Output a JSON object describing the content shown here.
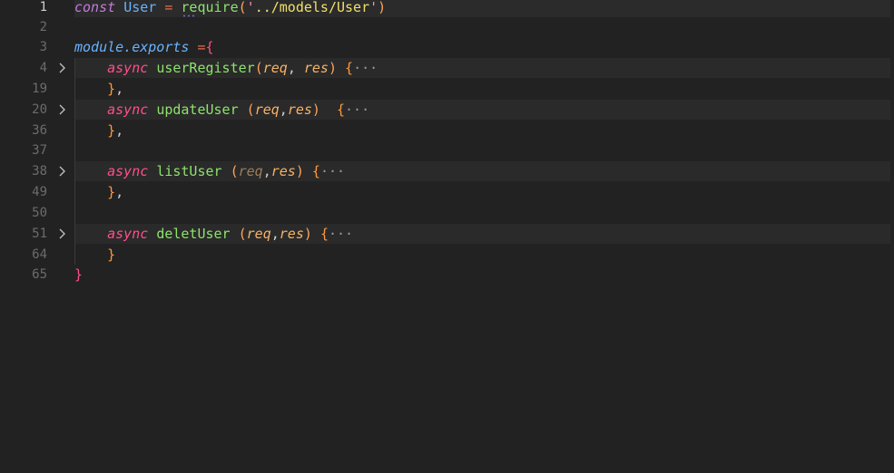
{
  "editor": {
    "lines": [
      {
        "num": "1",
        "kw": "const",
        "name": "User",
        "op": "=",
        "fn": "require",
        "open": "(",
        "q1": "'",
        "path": "../models/User",
        "q2": "'",
        "close": ")"
      },
      {
        "num": "2"
      },
      {
        "num": "3",
        "mod": "module.exports",
        "op": "=",
        "brace": "{"
      },
      {
        "num": "4",
        "async": "async",
        "fn": "userRegister",
        "open": "(",
        "p1": "req",
        "comma": ",",
        "p2": "res",
        "close": ")",
        "brace": "{",
        "ellipsis": "···"
      },
      {
        "num": "19",
        "brace": "}",
        "comma": ","
      },
      {
        "num": "20",
        "async": "async",
        "fn": "updateUser",
        "open": "(",
        "p1": "req",
        "comma": ",",
        "p2": "res",
        "close": ")",
        "brace": "{",
        "ellipsis": "···"
      },
      {
        "num": "36",
        "brace": "}",
        "comma": ","
      },
      {
        "num": "37"
      },
      {
        "num": "38",
        "async": "async",
        "fn": "listUser",
        "open": "(",
        "p1": "req",
        "comma": ",",
        "p2": "res",
        "close": ")",
        "brace": "{",
        "ellipsis": "···"
      },
      {
        "num": "49",
        "brace": "}",
        "comma": ","
      },
      {
        "num": "50"
      },
      {
        "num": "51",
        "async": "async",
        "fn": "deletUser",
        "open": "(",
        "p1": "req",
        "comma": ",",
        "p2": "res",
        "close": ")",
        "brace": "{",
        "ellipsis": "···"
      },
      {
        "num": "64",
        "brace": "}"
      },
      {
        "num": "65",
        "brace": "}"
      }
    ]
  }
}
